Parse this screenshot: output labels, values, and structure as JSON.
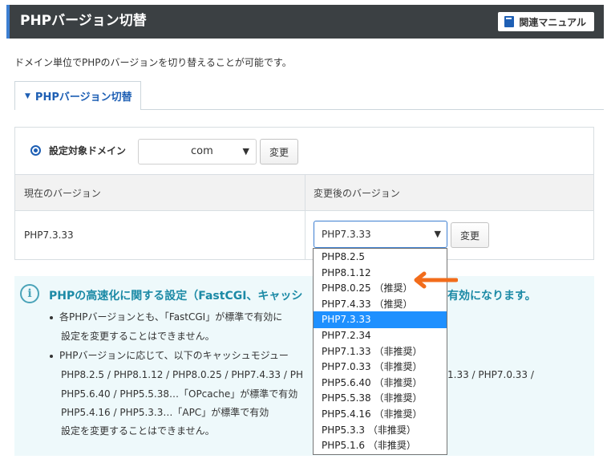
{
  "header": {
    "title": "PHPバージョン切替",
    "manual_label": "関連マニュアル"
  },
  "description": "ドメイン単位でPHPのバージョンを切り替えることが可能です。",
  "tab": {
    "label": "PHPバージョン切替"
  },
  "domain_row": {
    "label": "設定対象ドメイン",
    "select_value": "com",
    "button": "変更"
  },
  "table": {
    "head_current": "現在のバージョン",
    "head_new": "変更後のバージョン",
    "current_version": "PHP7.3.33",
    "selected_version": "PHP7.3.33",
    "button": "変更"
  },
  "info": {
    "title_a": "PHPの高速化に関する設定（FastCGI、キャッシ",
    "title_b": "有効になります。",
    "lines": [
      "各PHPバージョンとも、「FastCGI」が標準で有効に",
      "設定を変更することはできません。",
      "PHPバージョンに応じて、以下のキャッシュモジュー",
      "PHP8.2.5 / PHP8.1.12 / PHP8.0.25 / PHP7.4.33 / PH",
      "PHP5.6.40 / PHP5.5.38…「OPcache」が標準で有効",
      "PHP5.4.16 / PHP5.3.3…「APC」が標準で有効",
      "設定を変更することはできません。"
    ],
    "line3_tail": "1.33 / PHP7.0.33 /"
  },
  "dropdown": {
    "options": [
      "PHP8.2.5",
      "PHP8.1.12",
      "PHP8.0.25 （推奨）",
      "PHP7.4.33 （推奨）",
      "PHP7.3.33",
      "PHP7.2.34",
      "PHP7.1.33 （非推奨）",
      "PHP7.0.33 （非推奨）",
      "PHP5.6.40 （非推奨）",
      "PHP5.5.38 （非推奨）",
      "PHP5.4.16 （非推奨）",
      "PHP5.3.3 （非推奨）",
      "PHP5.1.6 （非推奨）"
    ],
    "selected_index": 4
  },
  "colors": {
    "accent": "#1e5fb4",
    "header_bg": "#3b4043",
    "highlight": "#1e90ff",
    "arrow": "#f26c1b"
  }
}
